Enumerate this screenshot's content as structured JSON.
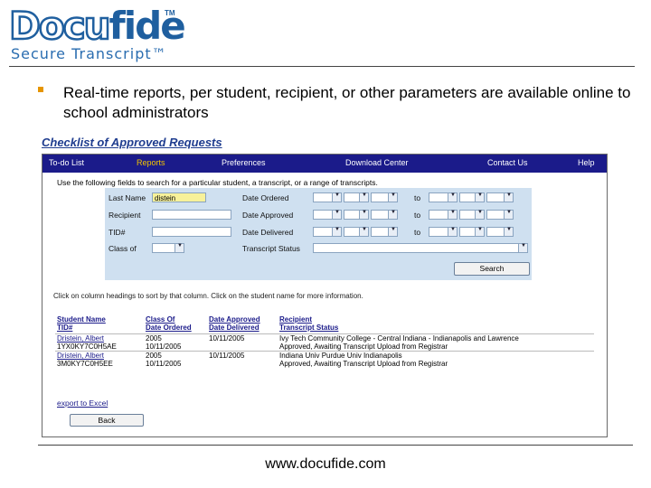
{
  "logo": {
    "doc": "Docu",
    "fide": "fide",
    "tm": "TM",
    "tagline": "Secure Transcript™"
  },
  "bullet": "Real-time reports, per student, recipient, or other parameters are available online to school administrators",
  "subtitle": "Checklist of Approved Requests",
  "nav": [
    "To-do List",
    "Reports",
    "Preferences",
    "Download Center",
    "Contact Us",
    "Help"
  ],
  "nav_active_index": 1,
  "instructions": "Use the following fields to search for a particular student, a transcript, or a range of transcripts.",
  "form": {
    "last_name_label": "Last Name",
    "last_name_value": "distein",
    "recipient_label": "Recipient",
    "tid_label": "TID#",
    "class_of_label": "Class of",
    "date_ordered_label": "Date Ordered",
    "date_approved_label": "Date Approved",
    "date_delivered_label": "Date Delivered",
    "transcript_status_label": "Transcript Status",
    "to_label": "to",
    "search_button": "Search"
  },
  "note": "Click on column headings to sort by that column. Click on the student name for more information.",
  "results": {
    "headers": [
      [
        "Student Name",
        "TID#"
      ],
      [
        "Class Of",
        "Date Ordered"
      ],
      [
        "Date Approved",
        "Date Delivered"
      ],
      [
        "Recipient",
        "Transcript Status"
      ]
    ],
    "rows": [
      {
        "name": "Dristein, Albert",
        "tid": "1YX0KY7C0H5AE",
        "class_of": "2005",
        "date_ordered": "10/11/2005",
        "date_approved": "10/11/2005",
        "date_delivered": "",
        "recipient": "Ivy Tech Community College - Central Indiana - Indianapolis and Lawrence",
        "status": "Approved, Awaiting Transcript Upload from Registrar"
      },
      {
        "name": "Dristein, Albert",
        "tid": "3M0KY7C0H5EE",
        "class_of": "2005",
        "date_ordered": "10/11/2005",
        "date_approved": "10/11/2005",
        "date_delivered": "",
        "recipient": "Indiana Univ Purdue Univ Indianapolis",
        "status": "Approved, Awaiting Transcript Upload from Registrar"
      }
    ]
  },
  "export_link": "export to Excel",
  "back_button": "Back",
  "footer_url": "www.docufide.com",
  "colors": {
    "brand_blue": "#1f5f9f",
    "nav_bg": "#1b1b8a",
    "nav_active": "#f3c400",
    "form_bg": "#cfe0f0",
    "bullet": "#e69500"
  }
}
